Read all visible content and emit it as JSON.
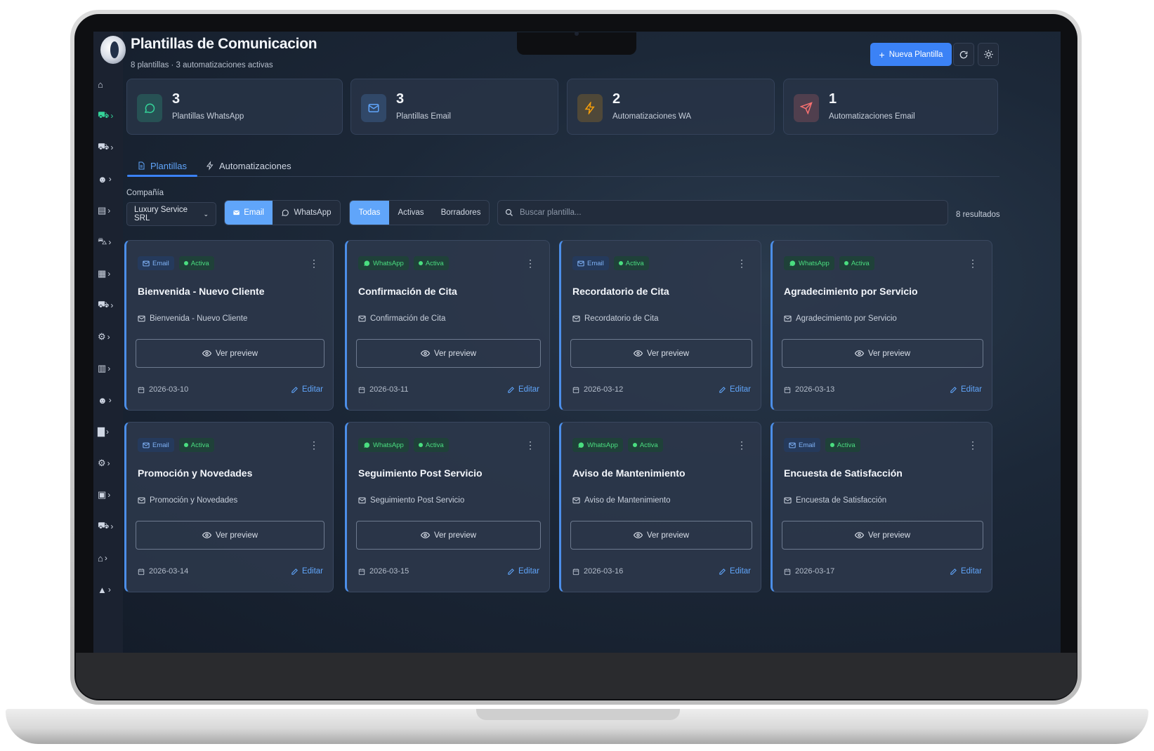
{
  "header": {
    "title": "Plantillas de Comunicacion",
    "subtitle": "8 plantillas · 3 automatizaciones activas",
    "new_button": "Nueva Plantilla",
    "refresh_icon": "refresh-icon",
    "theme_icon": "sun-icon"
  },
  "stats": [
    {
      "value": "3",
      "label": "Plantillas WhatsApp",
      "icon": "chat-bubble-icon",
      "color": "#34d399"
    },
    {
      "value": "3",
      "label": "Plantillas Email",
      "icon": "mail-icon",
      "color": "#60a5fa"
    },
    {
      "value": "2",
      "label": "Automatizaciones WA",
      "icon": "lightning-icon",
      "color": "#f59e0b"
    },
    {
      "value": "1",
      "label": "Automatizaciones Email",
      "icon": "send-icon",
      "color": "#f87171"
    }
  ],
  "tabs": [
    {
      "label": "Plantillas",
      "active": true
    },
    {
      "label": "Automatizaciones",
      "active": false
    }
  ],
  "filters": {
    "company_label": "Compañía",
    "company_value": "Luxury Service SRL",
    "channel": [
      "Email",
      "WhatsApp"
    ],
    "status": [
      "Todas",
      "Activas",
      "Borradores"
    ],
    "search_placeholder": "Buscar plantilla...",
    "results": "8 resultados"
  },
  "card_labels": {
    "preview": "Ver preview",
    "edit": "Editar",
    "status": "Activa"
  },
  "templates": [
    {
      "channel": "Email",
      "name": "Bienvenida - Nuevo Cliente",
      "subject": "Bienvenida - Nuevo Cliente",
      "date": "2026-03-10"
    },
    {
      "channel": "WhatsApp",
      "name": "Confirmación de Cita",
      "subject": "Confirmación de Cita",
      "date": "2026-03-11"
    },
    {
      "channel": "Email",
      "name": "Recordatorio de Cita",
      "subject": "Recordatorio de Cita",
      "date": "2026-03-12"
    },
    {
      "channel": "WhatsApp",
      "name": "Agradecimiento por Servicio",
      "subject": "Agradecimiento por Servicio",
      "date": "2026-03-13"
    },
    {
      "channel": "Email",
      "name": "Promoción y Novedades",
      "subject": "Promoción y Novedades",
      "date": "2026-03-14"
    },
    {
      "channel": "WhatsApp",
      "name": "Seguimiento Post Servicio",
      "subject": "Seguimiento Post Servicio",
      "date": "2026-03-15"
    },
    {
      "channel": "WhatsApp",
      "name": "Aviso de Mantenimiento",
      "subject": "Aviso de Mantenimiento",
      "date": "2026-03-16"
    },
    {
      "channel": "Email",
      "name": "Encuesta de Satisfacción",
      "subject": "Encuesta de Satisfacción",
      "date": "2026-03-17"
    }
  ],
  "sidebar": {
    "items": [
      {
        "icon": "home-icon"
      },
      {
        "icon": "cart-icon",
        "active": true
      },
      {
        "icon": "cart-icon"
      },
      {
        "icon": "users-icon"
      },
      {
        "icon": "document-icon"
      },
      {
        "icon": "car-icon"
      },
      {
        "icon": "calendar-icon"
      },
      {
        "icon": "cart-icon"
      },
      {
        "icon": "bikes-icon"
      },
      {
        "icon": "invoice-icon"
      },
      {
        "icon": "users-icon"
      },
      {
        "icon": "chart-icon"
      },
      {
        "icon": "gear-icon"
      },
      {
        "icon": "briefcase-icon"
      },
      {
        "icon": "cart-icon"
      },
      {
        "icon": "bank-icon"
      },
      {
        "icon": "lock-icon"
      }
    ]
  }
}
